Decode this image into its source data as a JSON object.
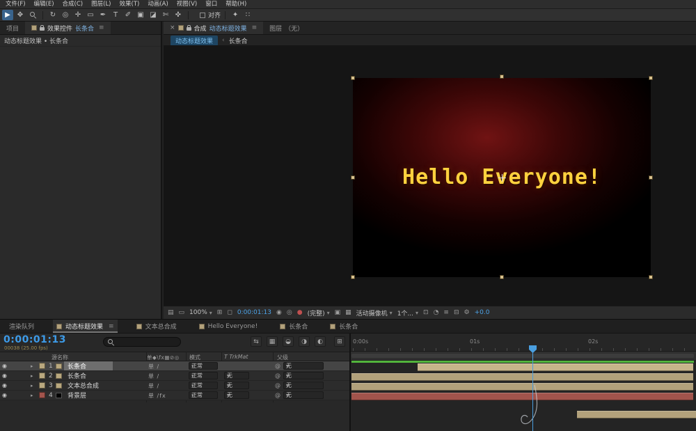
{
  "menu": {
    "items": [
      "文件(F)",
      "编辑(E)",
      "合成(C)",
      "图层(L)",
      "效果(T)",
      "动画(A)",
      "视图(V)",
      "窗口",
      "帮助(H)"
    ]
  },
  "toolbar": {
    "tools": [
      {
        "name": "selection-tool",
        "glyph": "▶",
        "active": true
      },
      {
        "name": "hand-tool",
        "glyph": "✥"
      },
      {
        "name": "zoom-tool",
        "glyph": ""
      },
      {
        "name": "rotate-tool",
        "glyph": "↻"
      },
      {
        "name": "camera-tool",
        "glyph": "◎"
      },
      {
        "name": "pan-behind-tool",
        "glyph": "✛"
      },
      {
        "name": "shape-tool",
        "glyph": "▭"
      },
      {
        "name": "pen-tool",
        "glyph": "✒"
      },
      {
        "name": "type-tool",
        "glyph": "T"
      },
      {
        "name": "brush-tool",
        "glyph": "✐"
      },
      {
        "name": "clone-stamp-tool",
        "glyph": "▣"
      },
      {
        "name": "eraser-tool",
        "glyph": "◪"
      },
      {
        "name": "roto-brush-tool",
        "glyph": "✄"
      },
      {
        "name": "puppet-pin-tool",
        "glyph": "✜"
      }
    ],
    "align_label": "对齐",
    "extra": [
      {
        "name": "snapping-icon",
        "glyph": "✦"
      },
      {
        "name": "grid-icon",
        "glyph": "∷"
      }
    ]
  },
  "left_panel": {
    "tabs": [
      {
        "label": "项目"
      },
      {
        "label": "效果控件",
        "accent": "长条合",
        "menu": "≡"
      }
    ],
    "comp_ref": "动态标题效果 • 长条合"
  },
  "comp_panel": {
    "tab": {
      "close": "×",
      "label": "合成",
      "accent": "动态标题效果",
      "menu": "≡"
    },
    "tab2": {
      "label": "图层",
      "value": "（无）"
    },
    "breadcrumb": {
      "chip": "动态标题效果",
      "sep": "‹",
      "current": "长条合"
    },
    "canvas": {
      "text": "Hello Everyone!",
      "text_color": "#ffd23e",
      "glow_color": "#701313"
    },
    "statusbar": {
      "zoom": "100%",
      "timecode": "0:00:01:13",
      "resolution": "(完整)",
      "camera": "活动摄像机",
      "views": "1个...",
      "exposure": "+0.0",
      "icons": [
        {
          "name": "always-preview-icon",
          "glyph": "▤"
        },
        {
          "name": "primary-viewer-icon",
          "glyph": "▭"
        },
        {
          "name": "grid-guides-icon",
          "glyph": "⊞"
        },
        {
          "name": "mask-visibility-icon",
          "glyph": "◻"
        },
        {
          "name": "snapshot-icon",
          "glyph": "◉"
        },
        {
          "name": "show-snapshot-icon",
          "glyph": "◎"
        },
        {
          "name": "channels-icon",
          "glyph": "●",
          "color": "#c05050"
        },
        {
          "name": "roi-icon",
          "glyph": "▣"
        },
        {
          "name": "transparency-grid-icon",
          "glyph": "▦"
        },
        {
          "name": "pixel-aspect-icon",
          "glyph": "⊡"
        },
        {
          "name": "fast-previews-icon",
          "glyph": "◔"
        },
        {
          "name": "timeline-icon",
          "glyph": "≡"
        },
        {
          "name": "flowchart-icon",
          "glyph": "⊟"
        },
        {
          "name": "exposure-gear-icon",
          "glyph": "⚙"
        }
      ]
    }
  },
  "timeline": {
    "tabs": [
      {
        "label": "渲染队列",
        "comp_icon": false
      },
      {
        "label": "动态标题效果",
        "comp_icon": true,
        "active": true,
        "menu": "≡"
      },
      {
        "label": "文本总合成",
        "comp_icon": true
      },
      {
        "label": "Hello Everyone!",
        "comp_icon": true
      },
      {
        "label": "长条合",
        "comp_icon": true
      },
      {
        "label": "长条合",
        "comp_icon": true
      }
    ],
    "current_time": "0:00:01:13",
    "frame_info": "00038 (25.00 fps)",
    "eye_glyph": "◉",
    "twirl_glyph": "▸",
    "pickwhip_glyph": "@",
    "toolbar_icons": [
      {
        "name": "mini-flowchart-icon",
        "glyph": "⇆"
      },
      {
        "name": "draft-3d-icon",
        "glyph": "▦"
      },
      {
        "name": "shy-icon",
        "glyph": "◒"
      },
      {
        "name": "frame-blend-icon",
        "glyph": "◑"
      },
      {
        "name": "motion-blur-icon",
        "glyph": "◐"
      },
      {
        "name": "graph-editor-icon",
        "glyph": "⊞"
      }
    ],
    "columns": {
      "name": "源名称",
      "switches": "单◆\\fx▦⊘◎",
      "mode": "模式",
      "trkmat": "T TrkMat",
      "parent": "父级"
    },
    "layers": [
      {
        "num": "1",
        "name": "长条合",
        "switches": "单 /",
        "mode": "正常",
        "trkmat": "",
        "parent": "无",
        "label_color": "#b9a87f",
        "icon_color": "#b9a87f",
        "selected": true
      },
      {
        "num": "2",
        "name": "长条合",
        "switches": "单 /",
        "mode": "正常",
        "trkmat": "无",
        "parent": "无",
        "label_color": "#b9a87f",
        "icon_color": "#b9a87f"
      },
      {
        "num": "3",
        "name": "文本总合成",
        "switches": "单 /",
        "mode": "正常",
        "trkmat": "无",
        "parent": "无",
        "label_color": "#b9a87f",
        "icon_color": "#b9a87f"
      },
      {
        "num": "4",
        "name": "背景层",
        "switches": "单 /fx",
        "mode": "正常",
        "trkmat": "无",
        "parent": "无",
        "label_color": "#a2544c",
        "icon_color": "#000000"
      }
    ],
    "ruler": {
      "t0": "0:00s",
      "t1": "01s",
      "t2": "02s"
    },
    "colors": {
      "accent_blue": "#3d9be8",
      "layer_tan": "#b2a17b",
      "layer_red": "#a2544c",
      "work_green": "#52b43c",
      "playhead_blue": "#4a9fe0"
    }
  }
}
